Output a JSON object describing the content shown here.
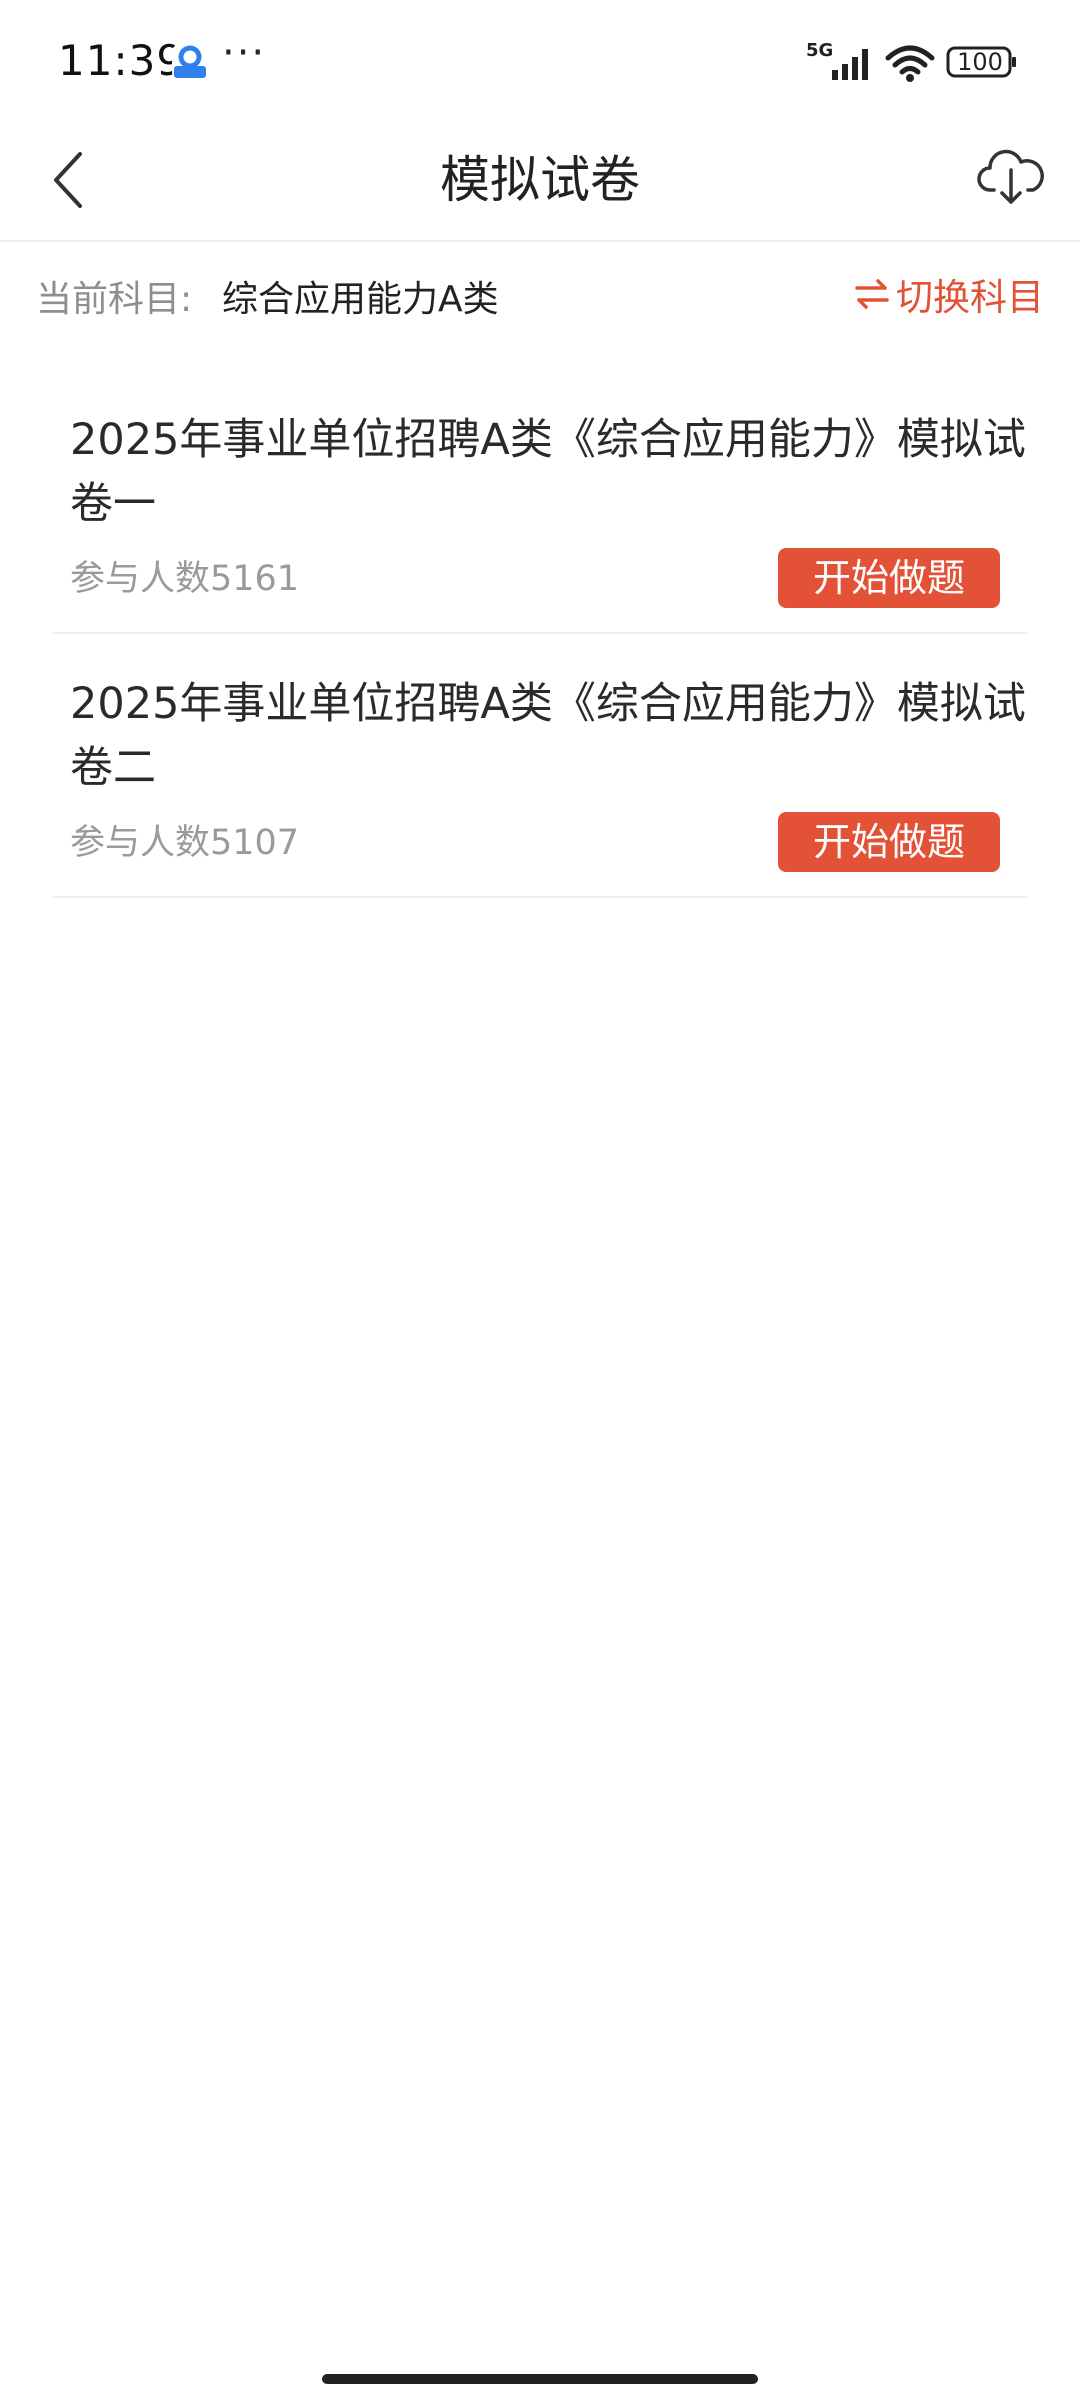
{
  "status_bar": {
    "time": "11:39",
    "more": "···",
    "network": "5G",
    "battery": "100"
  },
  "header": {
    "title": "模拟试卷",
    "back_icon": "chevron-left-icon",
    "download_icon": "cloud-download-icon"
  },
  "subject": {
    "label": "当前科目:",
    "value": "综合应用能力A类",
    "switch_label": "切换科目",
    "switch_icon": "swap-arrows-icon"
  },
  "exams": [
    {
      "title": "2025年事业单位招聘A类《综合应用能力》模拟试卷一",
      "count_label": "参与人数5161",
      "button": "开始做题"
    },
    {
      "title": "2025年事业单位招聘A类《综合应用能力》模拟试卷二",
      "count_label": "参与人数5107",
      "button": "开始做题"
    }
  ],
  "colors": {
    "accent": "#e35237",
    "muted_text": "#9a9a9a",
    "primary_text": "#222222"
  }
}
